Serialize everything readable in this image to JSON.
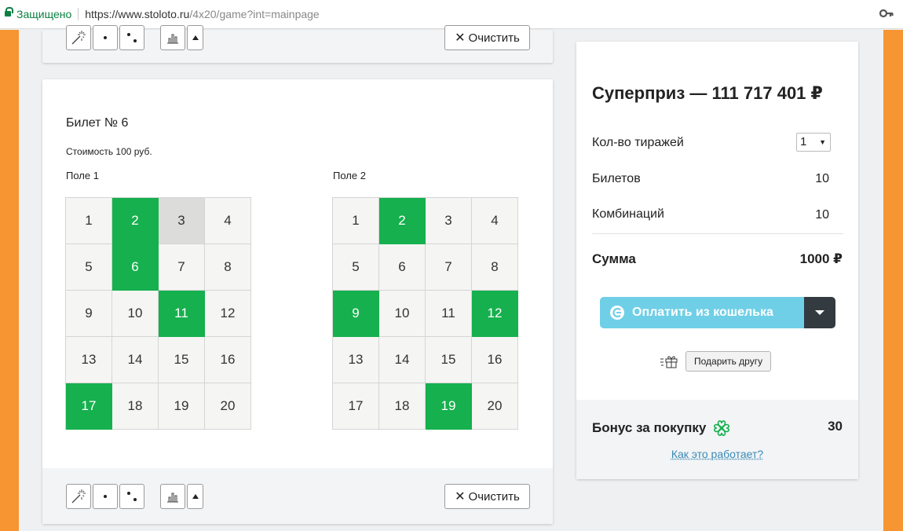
{
  "browser": {
    "secure_label": "Защищено",
    "url_host": "https://www.stoloto.ru",
    "url_path": "/4x20/game?int=mainpage"
  },
  "toolbar": {
    "clear_label": "Очистить",
    "clear_symbol": "✕",
    "tools": [
      "magic-wand-icon",
      "one-dot-icon",
      "two-dots-icon",
      "bar-chart-icon",
      "triangle-up-icon"
    ]
  },
  "ticket": {
    "title": "Билет № 6",
    "cost": "Стоимость 100 руб.",
    "fields": [
      {
        "label": "Поле 1",
        "numbers": [
          1,
          2,
          3,
          4,
          5,
          6,
          7,
          8,
          9,
          10,
          11,
          12,
          13,
          14,
          15,
          16,
          17,
          18,
          19,
          20
        ],
        "selected": [
          2,
          6,
          11,
          17
        ],
        "highlighted": [
          3
        ]
      },
      {
        "label": "Поле 2",
        "numbers": [
          1,
          2,
          3,
          4,
          5,
          6,
          7,
          8,
          9,
          10,
          11,
          12,
          13,
          14,
          15,
          16,
          17,
          18,
          19,
          20
        ],
        "selected": [
          2,
          9,
          12,
          19
        ],
        "highlighted": []
      }
    ]
  },
  "summary": {
    "prize": "Суперприз —  111 717 401 ₽",
    "draws_label": "Кол-во тиражей",
    "draws_value": "1",
    "tickets_label": "Билетов",
    "tickets_value": "10",
    "combos_label": "Комбинаций",
    "combos_value": "10",
    "sum_label": "Сумма",
    "sum_value": "1000 ₽",
    "pay_label": "Оплатить из кошелька",
    "gift_label": "Подарить другу",
    "bonus_label": "Бонус за покупку",
    "bonus_value": "30",
    "how_link": "Как это работает?"
  },
  "colors": {
    "accent_orange": "#f79533",
    "selected_green": "#16b04e",
    "pay_blue": "#6fcfe6",
    "link_blue": "#3a8ab5"
  }
}
